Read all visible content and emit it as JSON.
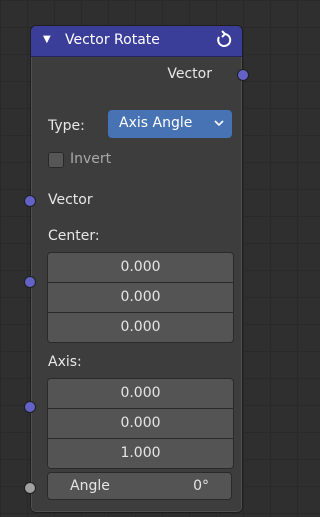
{
  "node": {
    "title": "Vector Rotate",
    "output_socket_label": "Vector",
    "type_label": "Type:",
    "type_value": "Axis Angle",
    "invert_label": "Invert",
    "vector_input_label": "Vector",
    "center_label": "Center:",
    "center_values": [
      "0.000",
      "0.000",
      "0.000"
    ],
    "axis_label": "Axis:",
    "axis_values": [
      "0.000",
      "0.000",
      "1.000"
    ],
    "angle_label": "Angle",
    "angle_value": "0°"
  },
  "colors": {
    "header": "#3b3e99",
    "dropdown": "#4772b3",
    "vector_socket": "#6363c7",
    "float_socket": "#a1a1a1"
  },
  "icons": {
    "collapse": "triangle-down-icon",
    "refresh": "refresh-icon",
    "dropdown": "chevron-down-icon"
  }
}
